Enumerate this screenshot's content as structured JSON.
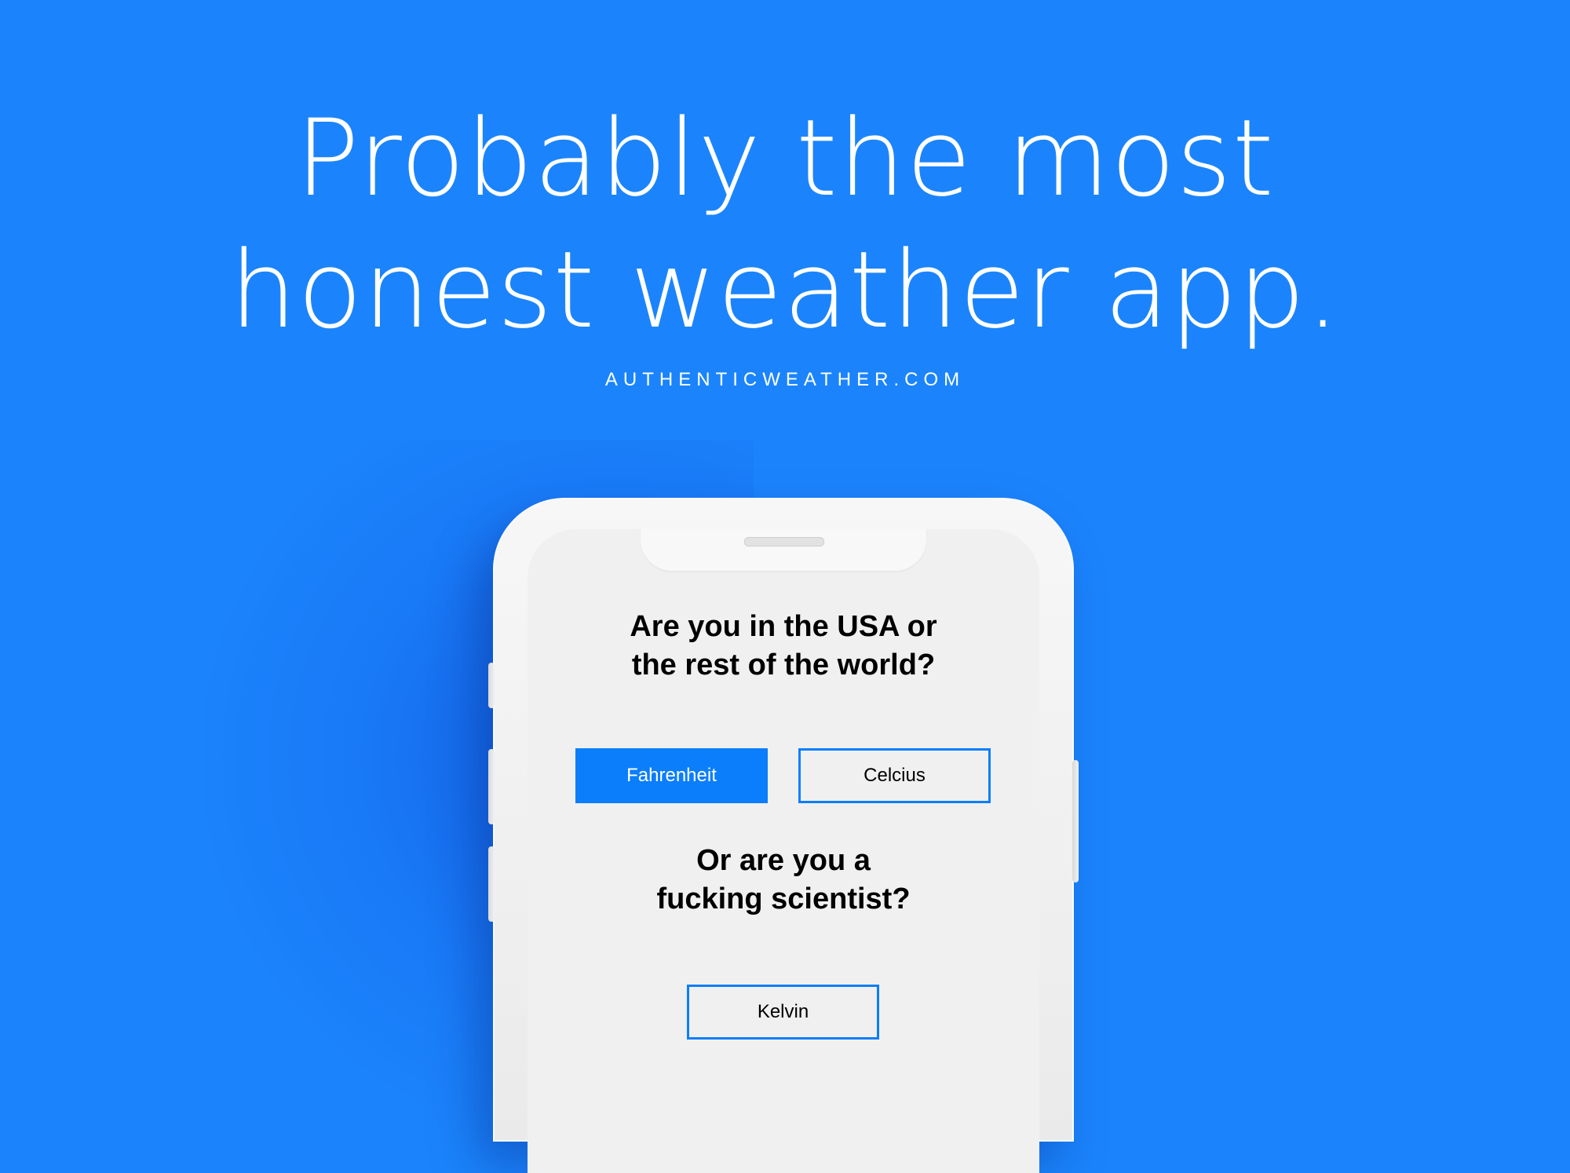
{
  "colors": {
    "background": "#1b84fc",
    "accent": "#0b7efc",
    "phone_body": "#f0f0f0"
  },
  "headline": {
    "line1": "Probably the most",
    "line2": "honest weather app."
  },
  "site_url": "AUTHENTICWEATHER.COM",
  "screen": {
    "question1": {
      "line1": "Are you in the USA or",
      "line2": "the rest of the world?"
    },
    "option_fahrenheit": "Fahrenheit",
    "option_celcius": "Celcius",
    "question2": {
      "line1": "Or are you a",
      "line2": "fucking scientist?"
    },
    "option_kelvin": "Kelvin",
    "selected_option": "Fahrenheit"
  }
}
